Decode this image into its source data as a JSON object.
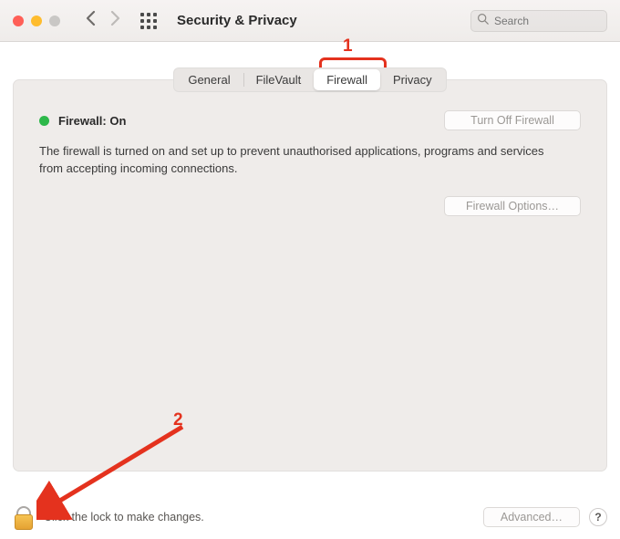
{
  "window": {
    "title": "Security & Privacy",
    "search_placeholder": "Search"
  },
  "tabs": {
    "items": [
      {
        "label": "General"
      },
      {
        "label": "FileVault"
      },
      {
        "label": "Firewall"
      },
      {
        "label": "Privacy"
      }
    ],
    "active_index": 2
  },
  "firewall": {
    "status_label": "Firewall: On",
    "status_color": "#2db84a",
    "turn_off_label": "Turn Off Firewall",
    "description": "The firewall is turned on and set up to prevent unauthorised applications, programs and services from accepting incoming connections.",
    "options_label": "Firewall Options…"
  },
  "footer": {
    "lock_text": "Click the lock to make changes.",
    "advanced_label": "Advanced…",
    "help_label": "?"
  },
  "annotations": {
    "callout1": "1",
    "callout2": "2"
  }
}
